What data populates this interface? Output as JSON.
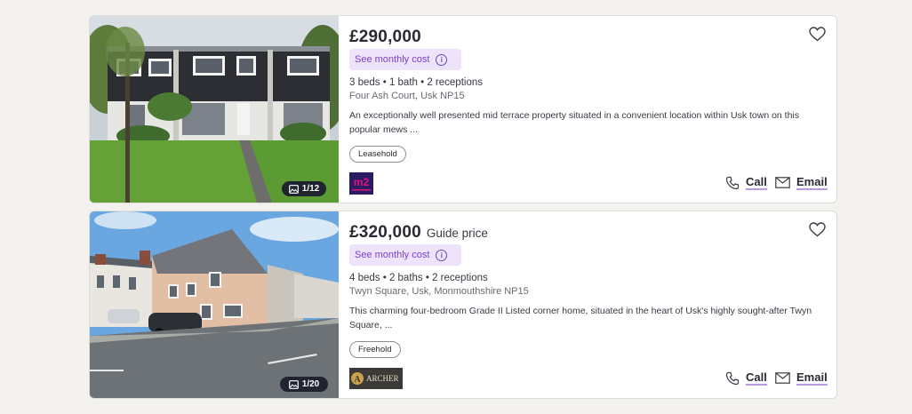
{
  "listings": [
    {
      "price": "£290,000",
      "price_qualifier": "",
      "monthly_cost_label": "See monthly cost",
      "specs": "3 beds • 1 bath • 2 receptions",
      "address": "Four Ash Court, Usk NP15",
      "description": "An exceptionally well presented mid terrace property situated in a convenient location within Usk town on this popular mews ...",
      "tenure": "Leasehold",
      "photo_counter": "1/12",
      "agent_logo": "m2",
      "call_label": "Call",
      "email_label": "Email"
    },
    {
      "price": "£320,000",
      "price_qualifier": "Guide price",
      "monthly_cost_label": "See monthly cost",
      "specs": "4 beds • 2 baths • 2 receptions",
      "address": "Twyn Square, Usk, Monmouthshire NP15",
      "description": "This charming four-bedroom Grade II Listed corner home, situated in the heart of Usk's highly sought-after Twyn Square, ...",
      "tenure": "Freehold",
      "photo_counter": "1/20",
      "agent_logo": "ARCHER",
      "call_label": "Call",
      "email_label": "Email"
    }
  ],
  "icons": {
    "favourite": "heart-outline-icon",
    "call": "phone-icon",
    "email": "envelope-icon",
    "gallery": "image-icon",
    "info": "info-icon"
  },
  "colors": {
    "monthly_bg": "#ede4fb",
    "monthly_text": "#7a3fd0",
    "link_underline": "#b89be0",
    "counter_bg": "#1f2430"
  }
}
